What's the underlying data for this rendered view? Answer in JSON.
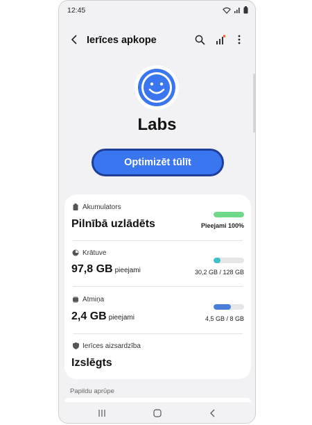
{
  "status_bar": {
    "time": "12:45"
  },
  "app_bar": {
    "title": "Ierīces apkope"
  },
  "hero": {
    "title": "Labs",
    "icon": "smiley-face-icon"
  },
  "optimize_button": {
    "label": "Optimizēt tūlīt"
  },
  "colors": {
    "accent": "#3a76f0",
    "battery_bar": "#6fd98a",
    "storage_bar": "#3ec1c9",
    "memory_bar": "#4a7fd9"
  },
  "card": {
    "battery": {
      "label": "Akumulators",
      "value": "Pilnībā uzlādēts",
      "note": "Pieejami 100%",
      "fill": 1.0
    },
    "storage": {
      "label": "Krātuve",
      "value": "97,8 GB",
      "suffix": "pieejami",
      "note": "30,2 GB / 128 GB",
      "fill": 0.236
    },
    "memory": {
      "label": "Atmiņa",
      "value": "2,4 GB",
      "suffix": "pieejami",
      "note": "4,5 GB / 8 GB",
      "fill": 0.5625
    },
    "security": {
      "label": "Ierīces aizsardzība",
      "value": "Izslēgts"
    }
  },
  "extra_section": {
    "title": "Papildu aprūpe"
  }
}
